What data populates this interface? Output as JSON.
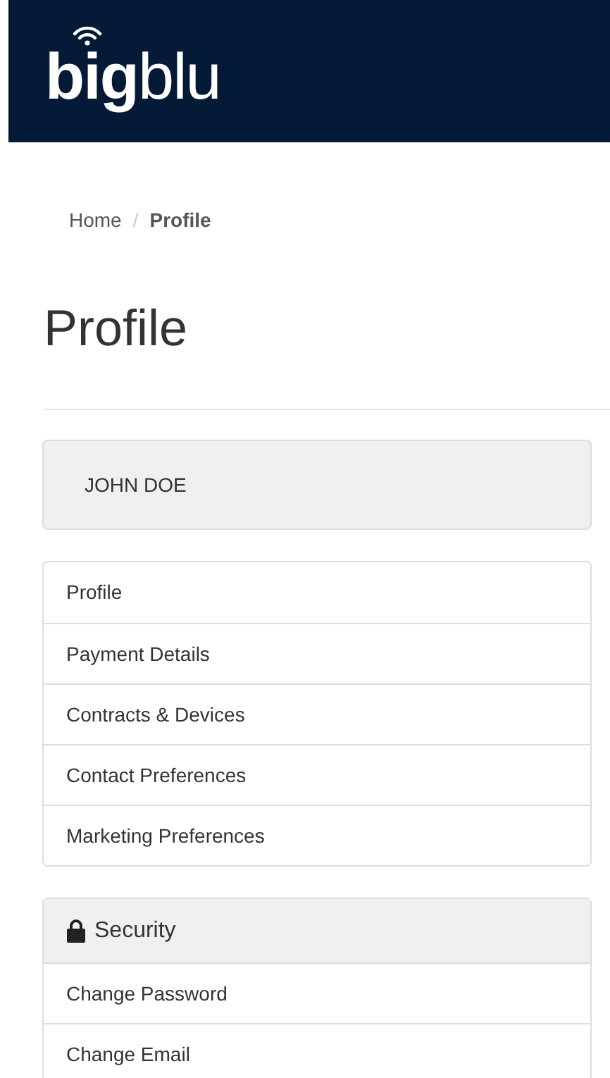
{
  "header": {
    "logo": "**big**blu"
  },
  "breadcrumb_separator": "/",
  "breadcrumb": [
    {
      "label": "Home",
      "selected": false
    },
    {
      "label": "Profile",
      "selected": true
    }
  ],
  "page_title": "Profile",
  "user_panel": {
    "name": "JOHN DOE"
  },
  "profile_menu": [
    {
      "label": "Profile"
    },
    {
      "label": "Payment Details"
    },
    {
      "label": "Contracts & Devices"
    },
    {
      "label": "Contact Preferences"
    },
    {
      "label": "Marketing Preferences"
    }
  ],
  "security_panel": {
    "title": "Security",
    "items": [
      {
        "label": "Change Password"
      },
      {
        "label": "Change Email"
      }
    ]
  }
}
